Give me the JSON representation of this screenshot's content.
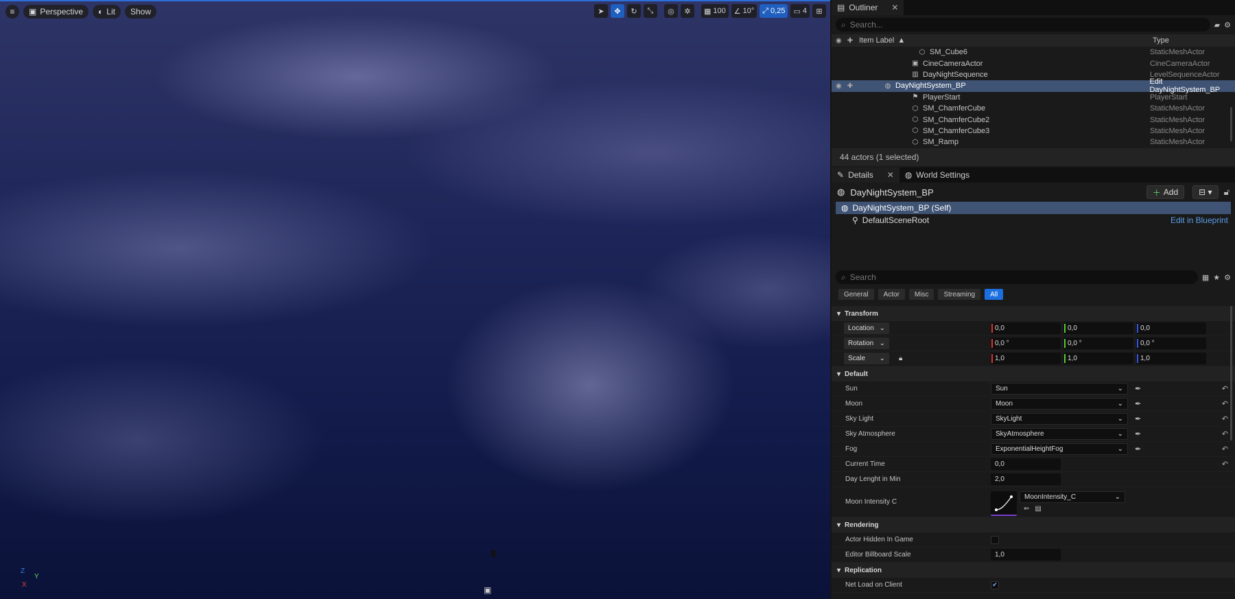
{
  "viewport": {
    "perspective_label": "Perspective",
    "lit_label": "Lit",
    "show_label": "Show",
    "grid_snap": "100",
    "angle_snap": "10°",
    "scale_snap": "0,25",
    "camera_speed": "4",
    "axis": {
      "z": "Z",
      "y": "Y",
      "x": "X"
    }
  },
  "outliner": {
    "tab_label": "Outliner",
    "search_placeholder": "Search...",
    "col_label": "Item Label",
    "col_type": "Type",
    "rows": [
      {
        "label": "SM_Cube6",
        "type": "StaticMeshActor"
      },
      {
        "label": "CineCameraActor",
        "type": "CineCameraActor"
      },
      {
        "label": "DayNightSequence",
        "type": "LevelSequenceActor"
      },
      {
        "label": "DayNightSystem_BP",
        "type": "Edit DayNightSystem_BP"
      },
      {
        "label": "PlayerStart",
        "type": "PlayerStart"
      },
      {
        "label": "SM_ChamferCube",
        "type": "StaticMeshActor"
      },
      {
        "label": "SM_ChamferCube2",
        "type": "StaticMeshActor"
      },
      {
        "label": "SM_ChamferCube3",
        "type": "StaticMeshActor"
      },
      {
        "label": "SM_Ramp",
        "type": "StaticMeshActor"
      }
    ],
    "footer": "44 actors (1 selected)"
  },
  "details": {
    "tab_label": "Details",
    "world_tab_label": "World Settings",
    "title": "DayNightSystem_BP",
    "add_label": "Add",
    "self_component": "DayNightSystem_BP (Self)",
    "root_component": "DefaultSceneRoot",
    "edit_blueprint": "Edit in Blueprint",
    "search_placeholder": "Search",
    "filters": [
      "General",
      "Actor",
      "Misc",
      "Streaming",
      "All"
    ],
    "transform": {
      "title": "Transform",
      "location": {
        "label": "Location",
        "x": "0,0",
        "y": "0,0",
        "z": "0,0"
      },
      "rotation": {
        "label": "Rotation",
        "x": "0,0 °",
        "y": "0,0 °",
        "z": "0,0 °"
      },
      "scale": {
        "label": "Scale",
        "x": "1,0",
        "y": "1,0",
        "z": "1,0"
      }
    },
    "default": {
      "title": "Default",
      "sun": {
        "label": "Sun",
        "value": "Sun"
      },
      "moon": {
        "label": "Moon",
        "value": "Moon"
      },
      "sky_light": {
        "label": "Sky Light",
        "value": "SkyLight"
      },
      "sky_atmosphere": {
        "label": "Sky Atmosphere",
        "value": "SkyAtmosphere"
      },
      "fog": {
        "label": "Fog",
        "value": "ExponentialHeightFog"
      },
      "current_time": {
        "label": "Current Time",
        "value": "0,0"
      },
      "day_length": {
        "label": "Day Lenght in Min",
        "value": "2,0"
      },
      "moon_intensity": {
        "label": "Moon Intensity C",
        "value": "MoonIntensity_C"
      }
    },
    "rendering": {
      "title": "Rendering",
      "hidden": {
        "label": "Actor Hidden In Game"
      },
      "billboard": {
        "label": "Editor Billboard Scale",
        "value": "1,0"
      }
    },
    "replication": {
      "title": "Replication",
      "net_load": {
        "label": "Net Load on Client"
      }
    }
  }
}
